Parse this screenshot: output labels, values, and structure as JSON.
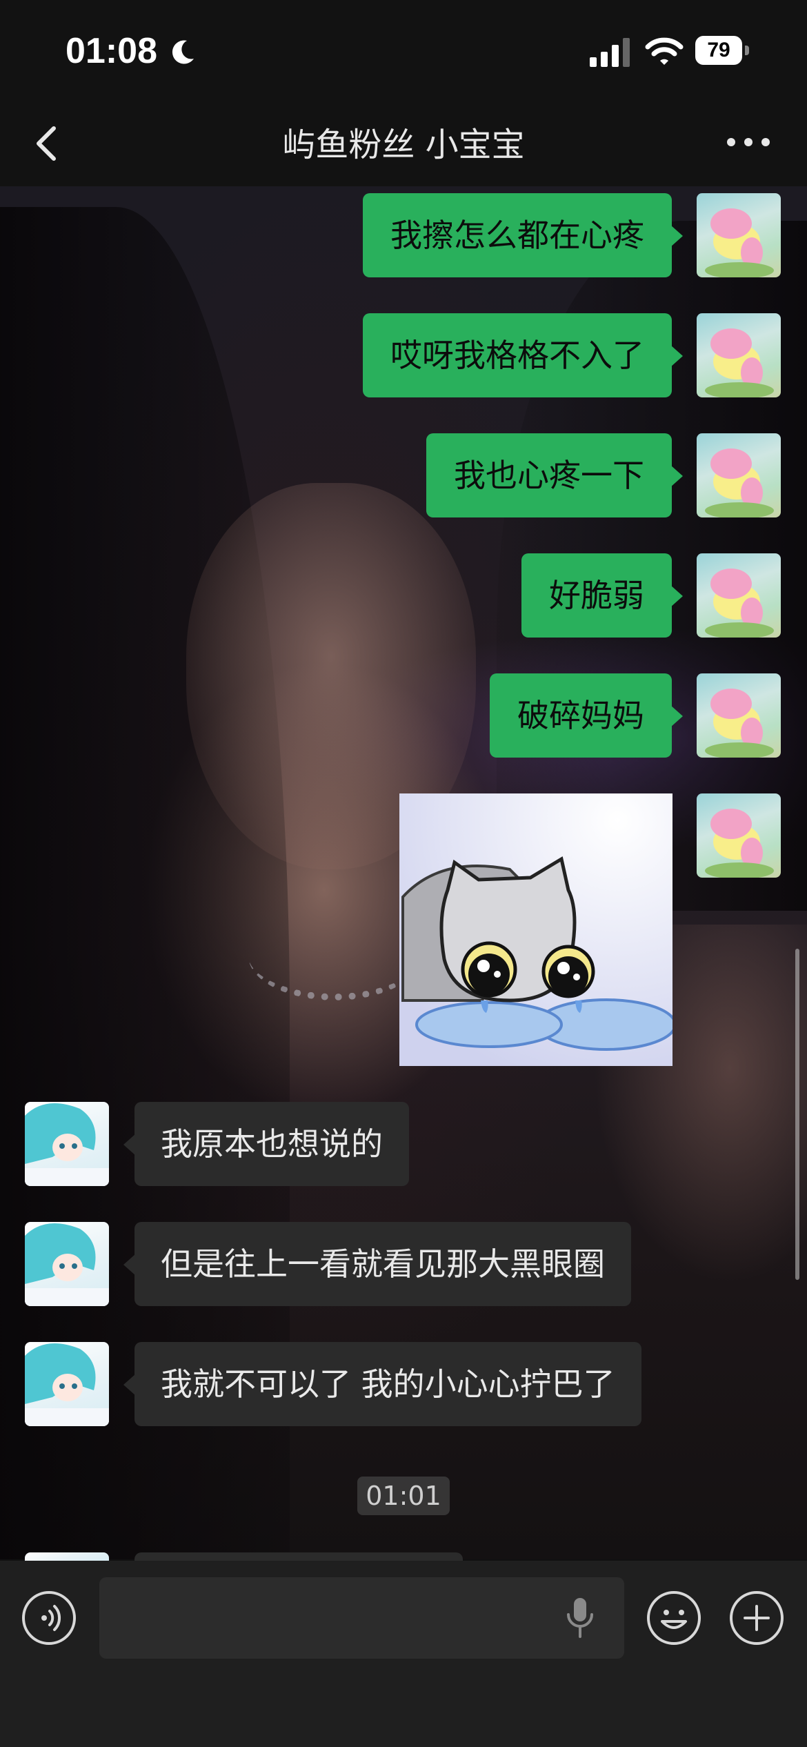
{
  "status_bar": {
    "time": "01:08",
    "battery": "79",
    "icons": [
      "moon-icon",
      "signal-icon",
      "wifi-icon",
      "battery-icon"
    ]
  },
  "nav": {
    "title": "屿鱼粉丝 小宝宝",
    "back_icon": "chevron-left-icon",
    "more_icon": "more-dots-icon"
  },
  "messages_out": [
    {
      "text": "我擦怎么都在心疼"
    },
    {
      "text": "哎呀我格格不入了"
    },
    {
      "text": "我也心疼一下"
    },
    {
      "text": "好脆弱"
    },
    {
      "text": "破碎妈妈"
    }
  ],
  "messages_in": [
    {
      "text": "我原本也想说的"
    },
    {
      "text": "但是往上一看就看见那大黑眼圈"
    },
    {
      "text": "我就不可以了 我的小心心拧巴了"
    }
  ],
  "timestamp": "01:01",
  "input_bar": {
    "voice_icon": "voice-icon",
    "mic_icon": "microphone-icon",
    "emoji_icon": "emoji-icon",
    "plus_icon": "plus-icon"
  },
  "colors": {
    "outgoing_bubble": "#29b05c",
    "incoming_bubble": "#2b2b2b",
    "bar_background": "#121212"
  }
}
